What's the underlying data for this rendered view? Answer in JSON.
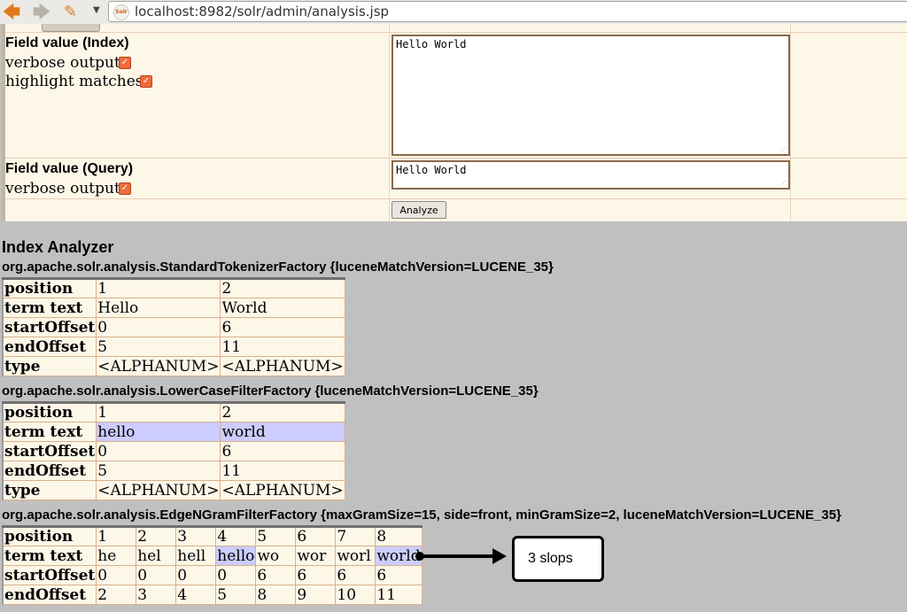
{
  "browser": {
    "url": "localhost:8982/solr/admin/analysis.jsp",
    "favicon_text": "Solr"
  },
  "form": {
    "index_label": "Field value (Index)",
    "verbose_label": "verbose output",
    "highlight_label": "highlight matches",
    "index_value": "Hello World",
    "query_label": "Field value (Query)",
    "query_verbose_label": "verbose output",
    "query_value": "Hello World",
    "analyze_label": "Analyze"
  },
  "analysis": {
    "heading": "Index Analyzer",
    "row_labels": [
      "position",
      "term text",
      "startOffset",
      "endOffset",
      "type"
    ],
    "stages": [
      {
        "factory": "org.apache.solr.analysis.StandardTokenizerFactory {luceneMatchVersion=LUCENE_35}",
        "tokens": [
          {
            "position": "1",
            "term": "Hello",
            "start": "0",
            "end": "5",
            "type": "<ALPHANUM>",
            "highlight": false
          },
          {
            "position": "2",
            "term": "World",
            "start": "6",
            "end": "11",
            "type": "<ALPHANUM>",
            "highlight": false
          }
        ]
      },
      {
        "factory": "org.apache.solr.analysis.LowerCaseFilterFactory {luceneMatchVersion=LUCENE_35}",
        "tokens": [
          {
            "position": "1",
            "term": "hello",
            "start": "0",
            "end": "5",
            "type": "<ALPHANUM>",
            "highlight": true
          },
          {
            "position": "2",
            "term": "world",
            "start": "6",
            "end": "11",
            "type": "<ALPHANUM>",
            "highlight": true
          }
        ]
      },
      {
        "factory": "org.apache.solr.analysis.EdgeNGramFilterFactory {maxGramSize=15, side=front, minGramSize=2, luceneMatchVersion=LUCENE_35}",
        "tokens": [
          {
            "position": "1",
            "term": "he",
            "start": "0",
            "end": "2",
            "highlight": false
          },
          {
            "position": "2",
            "term": "hel",
            "start": "0",
            "end": "3",
            "highlight": false
          },
          {
            "position": "3",
            "term": "hell",
            "start": "0",
            "end": "4",
            "highlight": false
          },
          {
            "position": "4",
            "term": "hello",
            "start": "0",
            "end": "5",
            "highlight": true
          },
          {
            "position": "5",
            "term": "wo",
            "start": "6",
            "end": "8",
            "highlight": false
          },
          {
            "position": "6",
            "term": "wor",
            "start": "6",
            "end": "9",
            "highlight": false
          },
          {
            "position": "7",
            "term": "worl",
            "start": "6",
            "end": "10",
            "highlight": false
          },
          {
            "position": "8",
            "term": "world",
            "start": "6",
            "end": "11",
            "highlight": true
          }
        ]
      }
    ]
  },
  "annotation": {
    "text": "3 slops"
  }
}
